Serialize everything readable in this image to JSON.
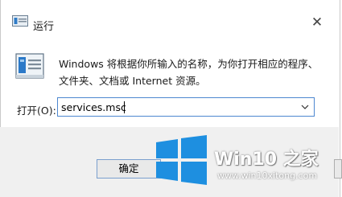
{
  "window": {
    "title": "运行",
    "close_glyph": "✕"
  },
  "dialog": {
    "description_line1": "Windows 将根据你所输入的名称，为你打开相应的程序、",
    "description_line2": "文件夹、文档或 Internet 资源。",
    "open_label": "打开(O):",
    "open_value": "services.msc",
    "ok_label": "确定"
  },
  "watermark": {
    "brand_text": "Win10 之家",
    "url": "www.win10xitong.com",
    "logo_color": "#1e8fe0"
  },
  "icons": {
    "title": "run-icon",
    "main": "run-icon",
    "dropdown": "chevron-down-icon",
    "watermark": "windows-logo-icon"
  }
}
